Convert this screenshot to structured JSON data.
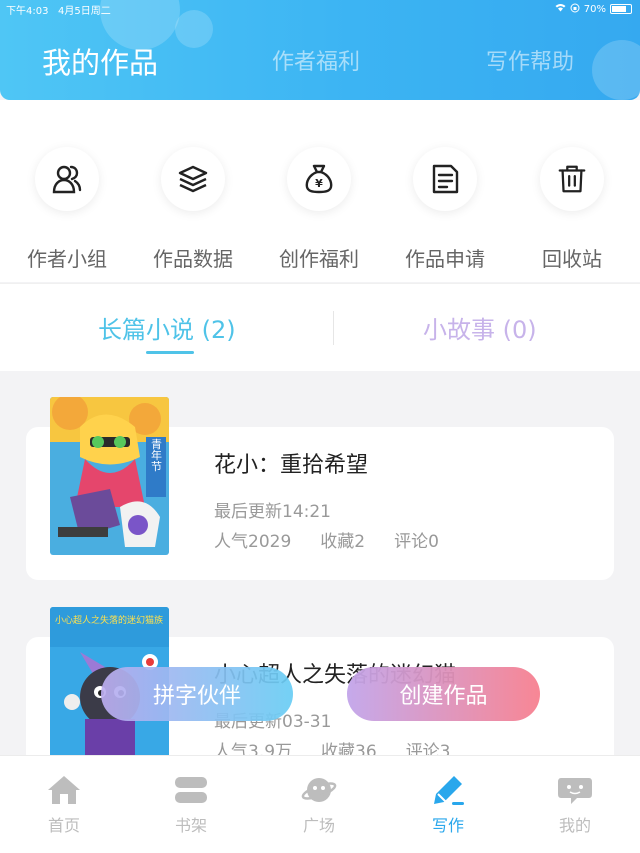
{
  "status_bar": {
    "time": "下午4:03",
    "date": "4月5日周二",
    "battery": "70%"
  },
  "header": {
    "tabs": [
      {
        "label": "我的作品",
        "active": true
      },
      {
        "label": "作者福利",
        "active": false
      },
      {
        "label": "写作帮助",
        "active": false
      }
    ]
  },
  "actions": [
    {
      "label": "作者小组",
      "icon": "people-icon"
    },
    {
      "label": "作品数据",
      "icon": "layers-icon"
    },
    {
      "label": "创作福利",
      "icon": "money-bag-icon"
    },
    {
      "label": "作品申请",
      "icon": "document-icon"
    },
    {
      "label": "回收站",
      "icon": "trash-icon"
    }
  ],
  "subtabs": [
    {
      "label": "长篇小说 (2)",
      "active": true
    },
    {
      "label": "小故事 (0)",
      "active": false
    }
  ],
  "works": [
    {
      "title": "花小：重拾希望",
      "updated": "最后更新14:21",
      "popularity": "人气2029",
      "favorites": "收藏2",
      "comments": "评论0",
      "cover_text": "青年节"
    },
    {
      "title": "小心超人之失落的迷幻猫",
      "updated": "最后更新03-31",
      "popularity": "人气3.9万",
      "favorites": "收藏36",
      "comments": "评论3",
      "cover_text": "小心超人之失落的迷幻猫族"
    }
  ],
  "floating_buttons": {
    "pair": "拼字伙伴",
    "create": "创建作品"
  },
  "tabbar": [
    {
      "label": "首页",
      "icon": "home-icon",
      "active": false
    },
    {
      "label": "书架",
      "icon": "bookshelf-icon",
      "active": false
    },
    {
      "label": "广场",
      "icon": "planet-icon",
      "active": false
    },
    {
      "label": "写作",
      "icon": "pen-icon",
      "active": true
    },
    {
      "label": "我的",
      "icon": "chat-face-icon",
      "active": false
    }
  ],
  "colors": {
    "accent": "#29a7ec",
    "header": "#3cb4f3",
    "subtab_active": "#4fc3e8",
    "subtab_inactive": "#c7b3ea"
  }
}
